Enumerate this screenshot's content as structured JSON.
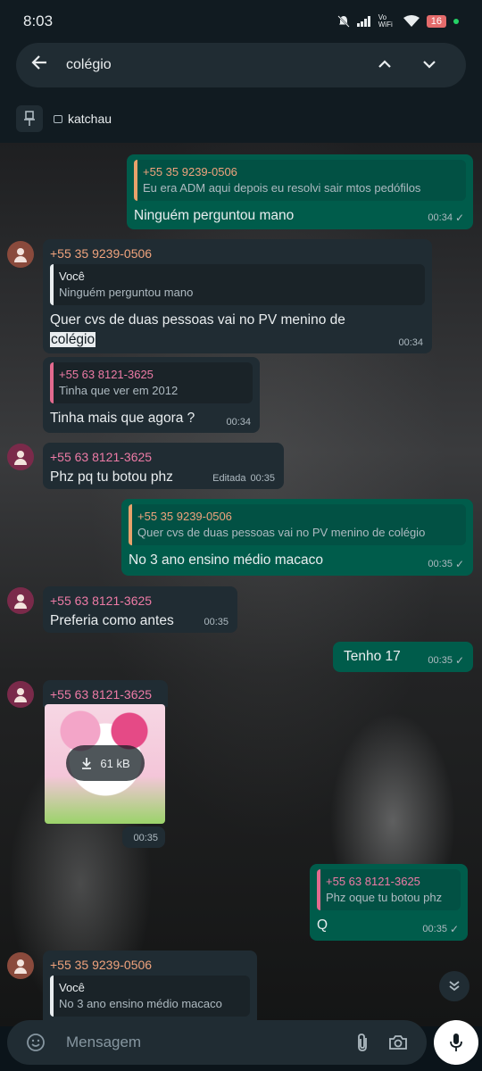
{
  "status": {
    "time": "8:03",
    "net": "Vo WiFi",
    "battery": "16"
  },
  "search": {
    "query": "colégio"
  },
  "pinned": {
    "label": "katchau"
  },
  "messages": {
    "m1": {
      "quote_name": "+55 35 9239-0506",
      "quote_text": "Eu era ADM aqui depois eu resolvi sair mtos pedófilos",
      "text": "Ninguém perguntou mano",
      "time": "00:34"
    },
    "m2": {
      "sender": "+55 35 9239-0506",
      "quote_name": "Você",
      "quote_text": "Ninguém perguntou mano",
      "text_before": "Quer cvs de duas pessoas vai no PV menino de",
      "text_highlight": "colégio",
      "time": "00:34"
    },
    "m3": {
      "quote_name": "+55 63 8121-3625",
      "quote_text": "Tinha que ver em 2012",
      "text": "Tinha mais que agora ?",
      "time": "00:34"
    },
    "m4": {
      "sender": "+55 63 8121-3625",
      "text": "Phz pq tu botou phz",
      "edited": "Editada",
      "time": "00:35"
    },
    "m5": {
      "quote_name": "+55 35 9239-0506",
      "quote_text": "Quer cvs de duas pessoas vai no PV menino de colégio",
      "text": "No 3 ano ensino médio macaco",
      "time": "00:35"
    },
    "m6": {
      "sender": "+55 63 8121-3625",
      "text": "Preferia como antes",
      "time": "00:35"
    },
    "m7": {
      "text": "Tenho 17",
      "time": "00:35"
    },
    "m8": {
      "sender": "+55 63 8121-3625",
      "size": "61 kB",
      "time": "00:35"
    },
    "m9": {
      "quote_name": "+55 63 8121-3625",
      "quote_text": "Phz oque tu botou phz",
      "text": "Q",
      "time": "00:35"
    },
    "m10": {
      "sender": "+55 35 9239-0506",
      "quote_name": "Você",
      "quote_text": "No 3 ano ensino médio macaco"
    }
  },
  "composer": {
    "placeholder": "Mensagem"
  },
  "colors": {
    "incoming": "#202c33",
    "outgoing": "#005c4b",
    "accent": "#25d366"
  }
}
